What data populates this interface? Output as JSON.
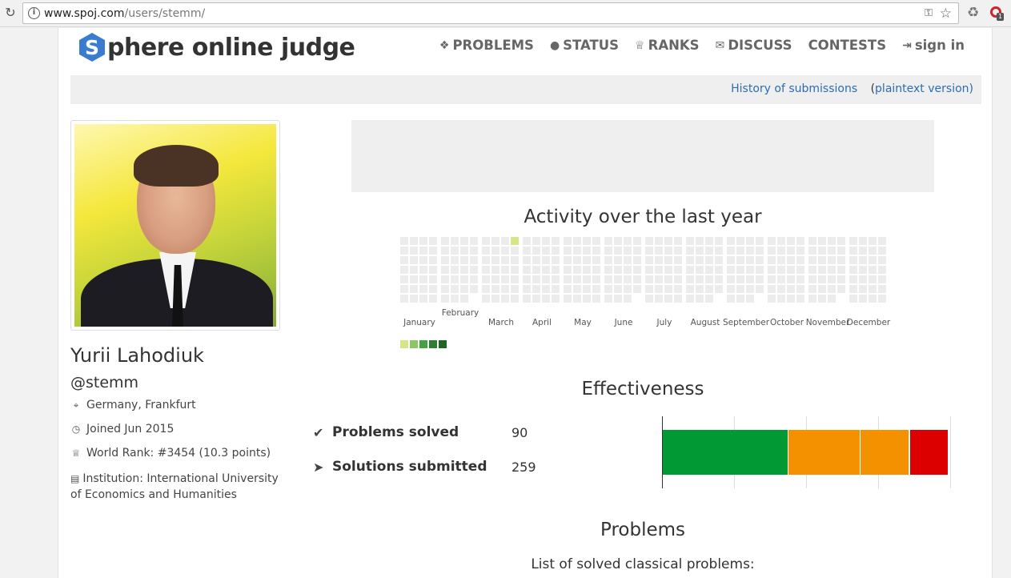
{
  "browser": {
    "url_host": "www.spoj.com",
    "url_path": "/users/stemm/",
    "extension_badge": "1"
  },
  "header": {
    "logo_letter": "S",
    "logo_text": "phere online judge",
    "nav": [
      {
        "label": "PROBLEMS",
        "icon": "puzzle-icon"
      },
      {
        "label": "STATUS",
        "icon": "circle-icon"
      },
      {
        "label": "RANKS",
        "icon": "trophy-icon"
      },
      {
        "label": "DISCUSS",
        "icon": "comments-icon"
      },
      {
        "label": "CONTESTS",
        "icon": ""
      },
      {
        "label": "sign in",
        "icon": "sign-in-icon"
      }
    ]
  },
  "subbar": {
    "history_link": "History of submissions",
    "plaintext_open": "(",
    "plaintext_link": "plaintext version",
    "plaintext_close": ")"
  },
  "profile": {
    "name": "Yurii Lahodiuk",
    "handle": "@stemm",
    "location": "Germany, Frankfurt",
    "joined": "Joined Jun 2015",
    "world_rank": "World Rank: #3454 (10.3 points)",
    "institution": "Institution: International University of Economics and Humanities"
  },
  "activity": {
    "title": "Activity over the last year",
    "months": [
      "January",
      "February",
      "March",
      "April",
      "May",
      "June",
      "July",
      "August",
      "September",
      "October",
      "November",
      "December"
    ],
    "legend_colors": [
      "#d6e685",
      "#8cc665",
      "#44a340",
      "#2e7d32",
      "#1e6823"
    ],
    "active_days": [
      {
        "month": "March",
        "week": 3,
        "day": 0
      }
    ]
  },
  "effectiveness": {
    "title": "Effectiveness",
    "problems_solved_label": "Problems solved",
    "problems_solved": "90",
    "solutions_submitted_label": "Solutions submitted",
    "solutions_submitted": "259"
  },
  "chart_data": {
    "type": "bar",
    "orientation": "horizontal-stacked",
    "series": [
      {
        "color": "#009933",
        "value": 0.44
      },
      {
        "color": "#f39100",
        "value": 0.25
      },
      {
        "color": "#f39100",
        "value": 0.17
      },
      {
        "color": "#dc0000",
        "value": 0.105
      },
      {
        "color": "#dc0000",
        "value": 0.03
      }
    ],
    "grid": true
  },
  "problems": {
    "title": "Problems",
    "list_title": "List of solved classical problems:"
  }
}
